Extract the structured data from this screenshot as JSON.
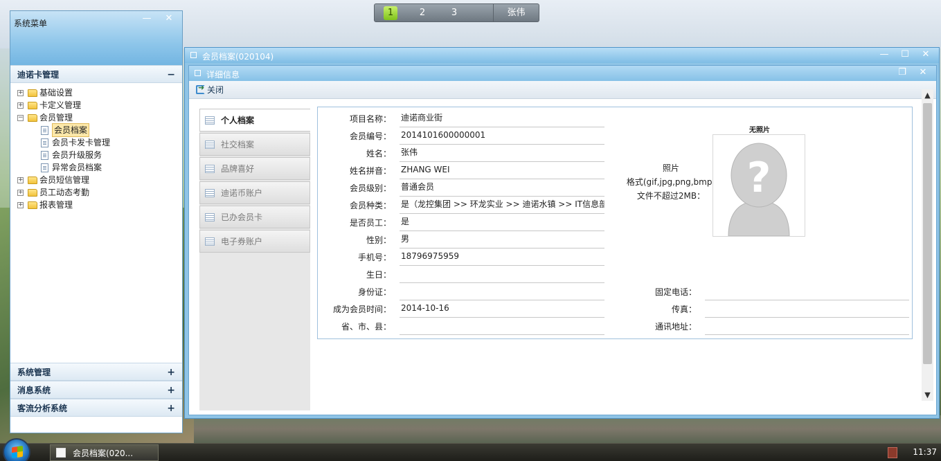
{
  "pager": {
    "pages": [
      "1",
      "2",
      "3"
    ],
    "active": "1",
    "user": "张伟"
  },
  "side": {
    "title": "系统菜单",
    "minimize": "—",
    "close": "✕",
    "accordion_top": {
      "label": "迪诺卡管理",
      "sign": "−"
    },
    "tree": [
      {
        "label": "基础设置",
        "expander": "+",
        "children": []
      },
      {
        "label": "卡定义管理",
        "expander": "+",
        "children": []
      },
      {
        "label": "会员管理",
        "expander": "−",
        "children": [
          "会员档案",
          "会员卡发卡管理",
          "会员升级服务",
          "异常会员档案"
        ]
      },
      {
        "label": "会员短信管理",
        "expander": "+",
        "children": []
      },
      {
        "label": "员工动态考勤",
        "expander": "+",
        "children": []
      },
      {
        "label": "报表管理",
        "expander": "+",
        "children": []
      }
    ],
    "accordion_bottom": [
      {
        "label": "系统管理",
        "sign": "+"
      },
      {
        "label": "消息系统",
        "sign": "+"
      },
      {
        "label": "客流分析系统",
        "sign": "+"
      }
    ]
  },
  "window": {
    "title": "会员档案(020104)",
    "minimize": "—",
    "maximize": "☐",
    "close": "✕"
  },
  "inner": {
    "title": "详细信息",
    "restore": "❐",
    "close": "✕",
    "toolbar_close": "关闭"
  },
  "tabs": [
    "个人档案",
    "社交档案",
    "品牌喜好",
    "迪诺币账户",
    "已办会员卡",
    "电子券账户"
  ],
  "form": {
    "left": [
      {
        "label": "项目名称：",
        "value": "迪诺商业街"
      },
      {
        "label": "会员编号：",
        "value": "2014101600000001"
      },
      {
        "label": "姓名：",
        "value": "张伟"
      },
      {
        "label": "姓名拼音：",
        "value": "ZHANG WEI"
      },
      {
        "label": "会员级别：",
        "value": "普通会员"
      },
      {
        "label": "会员种类：",
        "value": "是（龙控集团 >> 环龙实业 >> 迪诺水镇 >> IT信息部）"
      },
      {
        "label": "是否员工：",
        "value": "是"
      },
      {
        "label": "性别：",
        "value": "男"
      },
      {
        "label": "手机号：",
        "value": "18796975959"
      },
      {
        "label": "生日：",
        "value": ""
      },
      {
        "label": "身份证：",
        "value": ""
      },
      {
        "label": "成为会员时间：",
        "value": "2014-10-16"
      },
      {
        "label": "省、市、县：",
        "value": ""
      }
    ],
    "right": [
      {
        "label": "固定电话：",
        "value": ""
      },
      {
        "label": "传真：",
        "value": ""
      },
      {
        "label": "通讯地址：",
        "value": ""
      }
    ],
    "photo": {
      "label_line1": "照片",
      "label_line2": "格式(gif,jpg,png,bmp)",
      "label_line3": "文件不超过2MB：",
      "caption": "无照片"
    }
  },
  "taskbar": {
    "task_label": "会员档案(020...",
    "clock": "11:37"
  }
}
